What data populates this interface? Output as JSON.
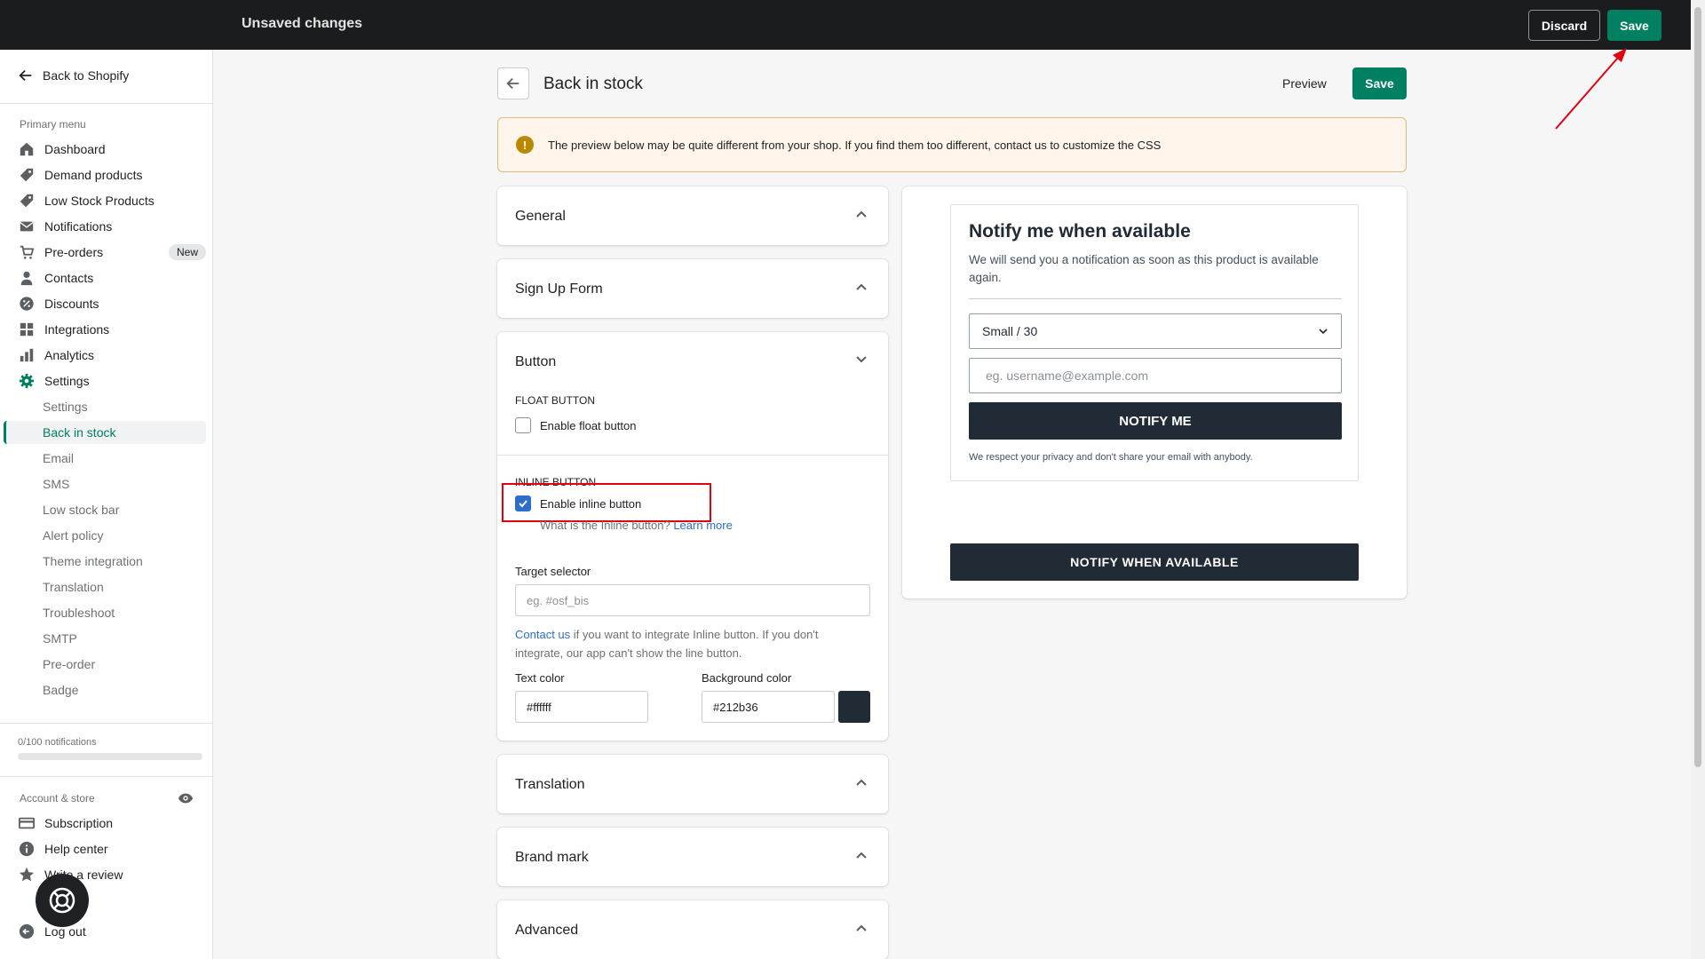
{
  "topbar": {
    "title": "Unsaved changes",
    "discard_label": "Discard",
    "save_label": "Save"
  },
  "sidebar": {
    "back_label": "Back to Shopify",
    "primary_menu_title": "Primary menu",
    "menu": [
      {
        "label": "Dashboard",
        "icon": "home-icon"
      },
      {
        "label": "Demand products",
        "icon": "tag-icon"
      },
      {
        "label": "Low Stock Products",
        "icon": "tag-icon"
      },
      {
        "label": "Notifications",
        "icon": "mail-icon"
      },
      {
        "label": "Pre-orders",
        "icon": "cart-icon",
        "badge": "New"
      },
      {
        "label": "Contacts",
        "icon": "person-icon"
      },
      {
        "label": "Discounts",
        "icon": "discount-icon"
      },
      {
        "label": "Integrations",
        "icon": "apps-icon"
      },
      {
        "label": "Analytics",
        "icon": "bar-chart-icon"
      },
      {
        "label": "Settings",
        "icon": "gear-icon"
      }
    ],
    "settings_items": [
      "Settings",
      "Back in stock",
      "Email",
      "SMS",
      "Low stock bar",
      "Alert policy",
      "Theme integration",
      "Translation",
      "Troubleshoot",
      "SMTP",
      "Pre-order",
      "Badge"
    ],
    "active_settings_item": "Back in stock",
    "notifications_count": "0/100 notifications",
    "notifications_progress": 0,
    "account_title": "Account & store",
    "account_items": [
      {
        "label": "Subscription",
        "icon": "credit-card-icon"
      },
      {
        "label": "Help center",
        "icon": "info-icon"
      },
      {
        "label": "Write a review",
        "icon": "star-icon"
      },
      {
        "label": "Log out",
        "icon": "logout-icon"
      }
    ]
  },
  "page": {
    "title": "Back in stock",
    "preview_label": "Preview",
    "save_label": "Save",
    "banner_text": "The preview below may be quite different from your shop. If you find them too different, contact us to customize the CSS"
  },
  "sections": {
    "general": "General",
    "signup": "Sign Up Form",
    "button": "Button",
    "translation": "Translation",
    "brand": "Brand mark",
    "advanced": "Advanced"
  },
  "button_section": {
    "float_title": "FLOAT BUTTON",
    "float_label": "Enable float button",
    "float_checked": false,
    "inline_title": "INLINE BUTTON",
    "inline_label": "Enable inline button",
    "inline_checked": true,
    "inline_help": "What is the Inline button?",
    "learn_more": "Learn more",
    "target_label": "Target selector",
    "target_placeholder": "eg. #osf_bis",
    "contact_link": "Contact us",
    "contact_help_1": " if you want to integrate Inline button. If you don't",
    "contact_help_2": "integrate, our app can't show the line button.",
    "text_color_label": "Text color",
    "text_color_value": "#ffffff",
    "bg_color_label": "Background color",
    "bg_color_value": "#212b36"
  },
  "preview": {
    "title": "Notify me when available",
    "description": "We will send you a notification as soon as this product is available again.",
    "variant": "Small / 30",
    "email_placeholder": "eg. username@example.com",
    "notify_label": "NOTIFY ME",
    "privacy": "We respect your privacy and don't share your email with anybody.",
    "notify_when_label": "NOTIFY WHEN AVAILABLE"
  },
  "colors": {
    "accent": "#008060",
    "active": "#007f5f",
    "link": "#2c6ecb",
    "dark": "#212b36",
    "highlight": "#e3000f"
  }
}
